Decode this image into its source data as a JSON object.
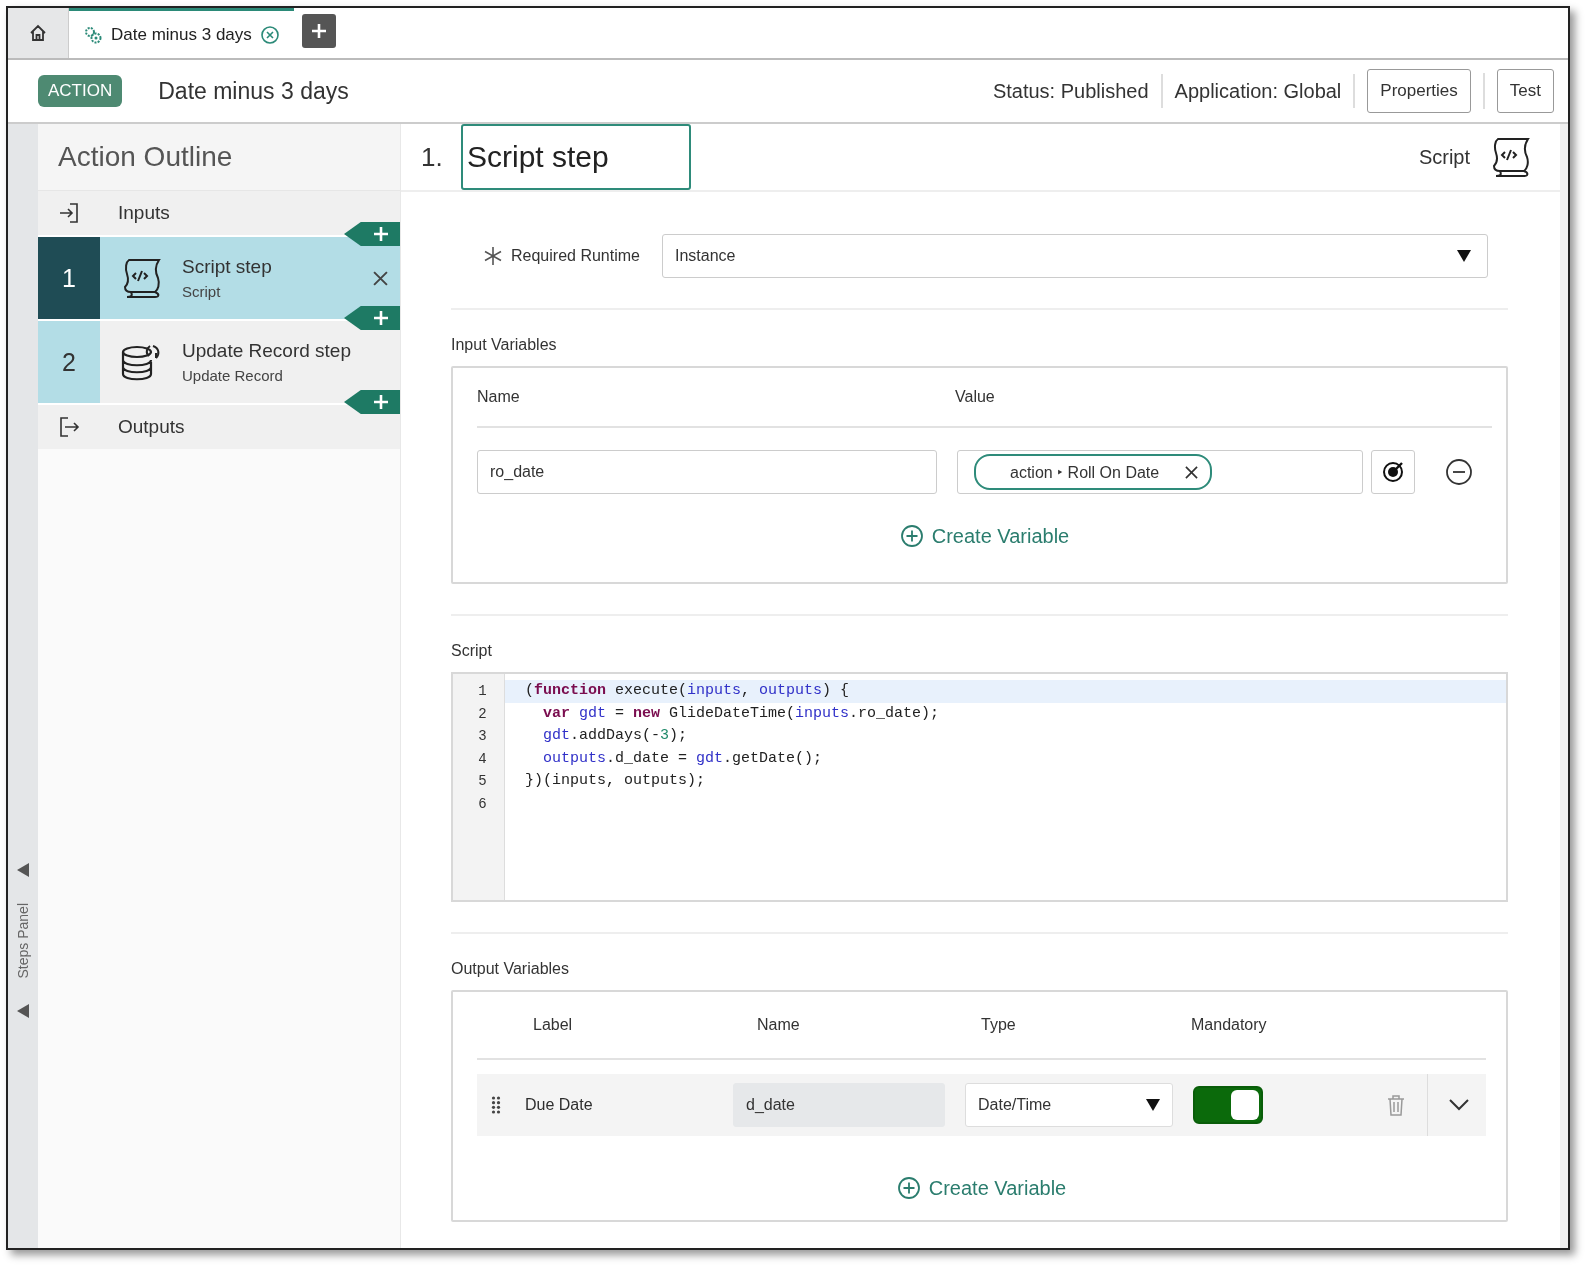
{
  "tabs": [
    {
      "kind": "home",
      "selected": false
    },
    {
      "kind": "action",
      "label": "Date minus 3 days",
      "selected": true
    }
  ],
  "header": {
    "badge": "ACTION",
    "title": "Date minus 3 days",
    "status": "Status: Published",
    "application": "Application: Global",
    "buttons": [
      "Properties",
      "Test"
    ]
  },
  "steps_panel": {
    "label": "Steps Panel"
  },
  "outline": {
    "title": "Action Outline",
    "inputs": "Inputs",
    "outputs": "Outputs",
    "steps": [
      {
        "number": "1",
        "name": "Script step",
        "type": "Script",
        "kind": "script",
        "selected": true
      },
      {
        "number": "2",
        "name": "Update Record step",
        "type": "Update Record",
        "kind": "record",
        "selected": false
      }
    ]
  },
  "step": {
    "number": "1.",
    "name": "Script step",
    "type": "Script",
    "required_runtime": {
      "label": "Required Runtime",
      "value": "Instance"
    },
    "input_variables": {
      "title": "Input Variables",
      "columns": [
        "Name",
        "Value"
      ],
      "rows": [
        {
          "name": "ro_date",
          "value": "action ‣ Roll On Date"
        }
      ],
      "create": "Create Variable"
    },
    "script": {
      "title": "Script",
      "lines": [
        {
          "number": "1",
          "active": true,
          "tokens": [
            {
              "text": "(",
              "kind": "plain"
            },
            {
              "text": "function",
              "kind": "keyword"
            },
            {
              "text": " execute(",
              "kind": "plain"
            },
            {
              "text": "inputs",
              "kind": "variable"
            },
            {
              "text": ", ",
              "kind": "plain"
            },
            {
              "text": "outputs",
              "kind": "variable"
            },
            {
              "text": ") {",
              "kind": "plain"
            }
          ]
        },
        {
          "number": "2",
          "active": false,
          "tokens": [
            {
              "text": "  var ",
              "kind": "keyword"
            },
            {
              "text": "gdt",
              "kind": "variable"
            },
            {
              "text": " = ",
              "kind": "plain"
            },
            {
              "text": "new",
              "kind": "keyword"
            },
            {
              "text": " GlideDateTime(",
              "kind": "plain"
            },
            {
              "text": "inputs",
              "kind": "variable"
            },
            {
              "text": ".ro_date);",
              "kind": "plain"
            }
          ]
        },
        {
          "number": "3",
          "active": false,
          "tokens": [
            {
              "text": "  gdt",
              "kind": "variable"
            },
            {
              "text": ".addDays(-",
              "kind": "plain"
            },
            {
              "text": "3",
              "kind": "number"
            },
            {
              "text": ");",
              "kind": "plain"
            }
          ]
        },
        {
          "number": "4",
          "active": false,
          "tokens": [
            {
              "text": "  outputs",
              "kind": "variable"
            },
            {
              "text": ".d_date = ",
              "kind": "plain"
            },
            {
              "text": "gdt",
              "kind": "variable"
            },
            {
              "text": ".getDate();",
              "kind": "plain"
            }
          ]
        },
        {
          "number": "5",
          "active": false,
          "tokens": [
            {
              "text": "})(inputs, outputs);",
              "kind": "plain"
            }
          ]
        },
        {
          "number": "6"
        }
      ]
    },
    "output_variables": {
      "title": "Output Variables",
      "columns": [
        "Label",
        "Name",
        "Type",
        "Mandatory"
      ],
      "rows": [
        {
          "label": "Due Date",
          "name": "d_date",
          "type": "Date/Time",
          "mandatory": true
        }
      ],
      "create": "Create Variable"
    }
  }
}
